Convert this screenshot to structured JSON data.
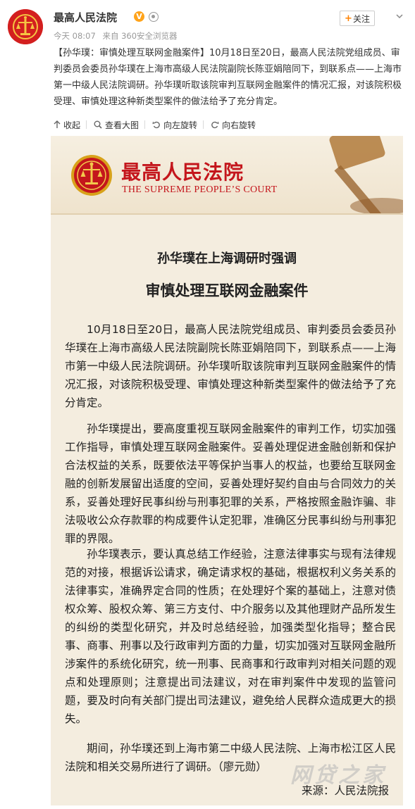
{
  "post": {
    "account_name": "最高人民法院",
    "verified_badge": "V",
    "time": "今天 08:07",
    "source": "来自 360安全浏览器",
    "follow_label": "关注",
    "text": "【孙华璞：审慎处理互联网金融案件】10月18日至20日，最高人民法院党组成员、审判委员会委员孙华璞在上海市高级人民法院副院长陈亚娟陪同下，到联系点——上海市第一中级人民法院调研。孙华璞听取该院审判互联网金融案件的情况汇报，对该院积极受理、审慎处理这种新类型案件的做法给予了充分肯定。"
  },
  "media_actions": {
    "collapse": "收起",
    "view_large": "查看大图",
    "rotate_left": "向左旋转",
    "rotate_right": "向右旋转"
  },
  "image": {
    "court_cn": "最高人民法院",
    "court_en": "THE SUPREME PEOPLE’S COURT",
    "subtitle": "孙华璞在上海调研时强调",
    "headline": "审慎处理互联网金融案件",
    "paragraphs": [
      "10月18日至20日，最高人民法院党组成员、审判委员会委员孙华璞在上海市高级人民法院副院长陈亚娟陪同下，到联系点——上海市第一中级人民法院调研。孙华璞听取该院审判互联网金融案件的情况汇报，对该院积极受理、审慎处理这种新类型案件的做法给予了充分肯定。",
      "孙华璞提出，要高度重视互联网金融案件的审判工作，切实加强工作指导，审慎处理互联网金融案件。妥善处理促进金融创新和保护合法权益的关系，既要依法平等保护当事人的权益，也要给互联网金融的创新发展留出适度的空间，妥善处理好契约自由与合同效力的关系，妥善处理好民事纠纷与刑事犯罪的关系，严格按照金融诈骗、非法吸收公众存款罪的构成要件认定犯罪，准确区分民事纠纷与刑事犯罪的界限。",
      "孙华璞表示，要认真总结工作经验，注意法律事实与现有法律规范的对接，根据诉讼请求，确定请求权的基础，根据权利义务关系的法律事实，准确界定合同的性质；在处理好个案的基础上，注意对债权众筹、股权众筹、第三方支付、中介服务以及其他理财产品所发生的纠纷的类型化研究，并及时总结经验，加强类型化指导；整合民事、商事、刑事以及行政审判方面的力量，切实加强对互联网金融所涉案件的系统化研究，统一刑事、民商事和行政审判对相关问题的观点和处理原则；注意提出司法建议，对在审判案件中发现的监管问题，要及时向有关部门提出司法建议，避免给人民群众造成更大的损失。",
      "期间，孙华璞还到上海市第二中级人民法院、上海市松江区人民法院和相关交易所进行了调研。（廖元勋）"
    ],
    "source_line": "来源：人民法院报",
    "watermark": "网贷之家"
  },
  "colors": {
    "court_red": "#c4161c",
    "accent_orange": "#ff8200",
    "verified_yellow": "#ffa31a"
  },
  "icons": [
    "court-emblem-icon",
    "verified-icon",
    "vip-icon",
    "plus-icon",
    "chevron-down-icon",
    "collapse-icon",
    "search-icon",
    "rotate-left-icon",
    "rotate-right-icon",
    "gavel-icon"
  ]
}
